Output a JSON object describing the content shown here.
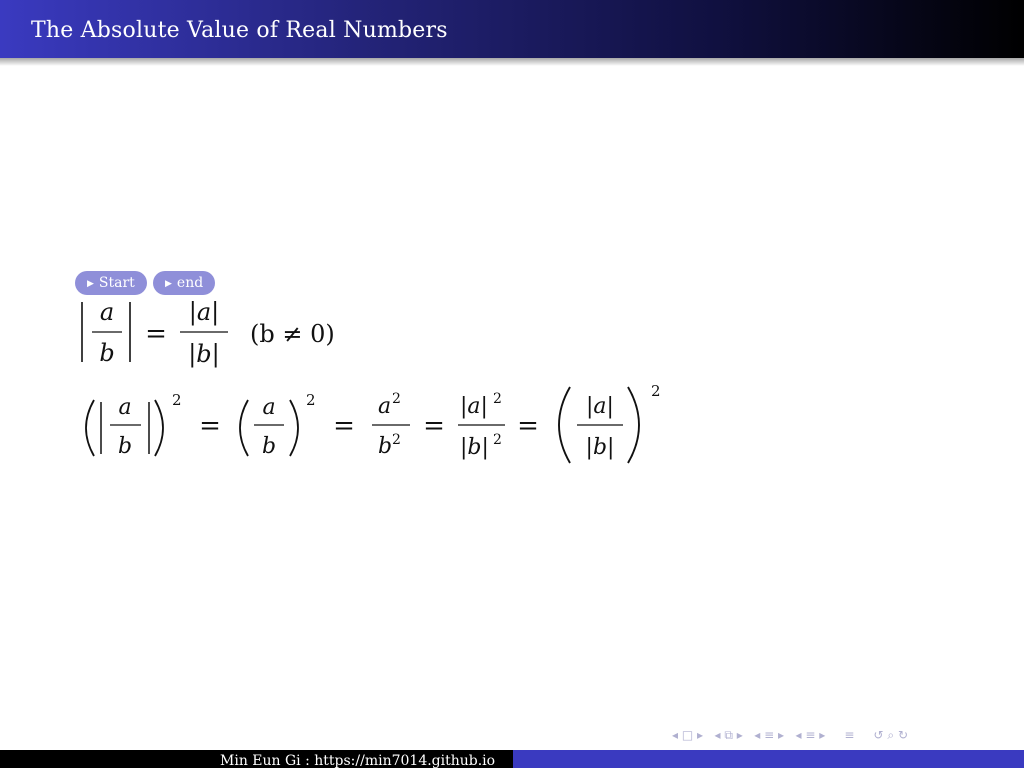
{
  "header": {
    "title": "The Absolute Value of Real Numbers"
  },
  "buttons": {
    "start_label": "Start",
    "end_label": "end",
    "triangle_icon": "▶"
  },
  "equation1": {
    "numerator_a": "a",
    "denominator_b": "b",
    "equals": "=",
    "abs_a": "|a|",
    "abs_b": "|b|",
    "condition": "(b ≠ 0)"
  },
  "equation2": {
    "a": "a",
    "b": "b",
    "exp": "2",
    "equals": "=",
    "a_sq": "a",
    "b_sq": "b",
    "abs_a": "|a|",
    "abs_b": "|b|"
  },
  "footer": {
    "author": "Min Eun Gi : https://min7014.github.io"
  },
  "nav": {
    "icons": [
      "◂",
      "□",
      "▸",
      "◂",
      "⧉",
      "▸",
      "◂",
      "≡",
      "▸",
      "◂",
      "≡",
      "▸",
      "≡",
      "↺",
      "⌕",
      "↻"
    ]
  }
}
